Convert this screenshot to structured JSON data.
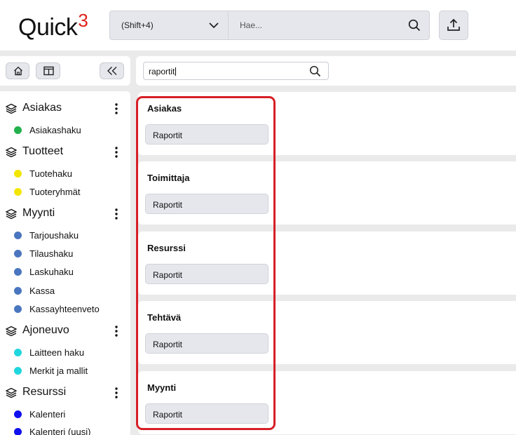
{
  "header": {
    "logo_text": "Quick",
    "logo_suffix": "3",
    "scope_label": "(Shift+4)",
    "search_placeholder": "Hae..."
  },
  "filter": {
    "value": "raportit"
  },
  "sidebar": {
    "groups": [
      {
        "label": "Asiakas",
        "items": [
          {
            "label": "Asiakashaku",
            "color": "#22b14c"
          }
        ]
      },
      {
        "label": "Tuotteet",
        "items": [
          {
            "label": "Tuotehaku",
            "color": "#f2e600"
          },
          {
            "label": "Tuoteryhmät",
            "color": "#f2e600"
          }
        ]
      },
      {
        "label": "Myynti",
        "items": [
          {
            "label": "Tarjoushaku",
            "color": "#4a76c0"
          },
          {
            "label": "Tilaushaku",
            "color": "#4a76c0"
          },
          {
            "label": "Laskuhaku",
            "color": "#4a76c0"
          },
          {
            "label": "Kassa",
            "color": "#4a76c0"
          },
          {
            "label": "Kassayhteenveto",
            "color": "#4a76c0"
          }
        ]
      },
      {
        "label": "Ajoneuvo",
        "items": [
          {
            "label": "Laitteen haku",
            "color": "#1fd6de"
          },
          {
            "label": "Merkit ja mallit",
            "color": "#1fd6de"
          }
        ]
      },
      {
        "label": "Resurssi",
        "items": [
          {
            "label": "Kalenteri",
            "color": "#1010ee"
          },
          {
            "label": "Kalenteri (uusi)",
            "color": "#1010ee"
          }
        ]
      }
    ]
  },
  "results": [
    {
      "title": "Asiakas",
      "button": "Raportit"
    },
    {
      "title": "Toimittaja",
      "button": "Raportit"
    },
    {
      "title": "Resurssi",
      "button": "Raportit"
    },
    {
      "title": "Tehtävä",
      "button": "Raportit"
    },
    {
      "title": "Myynti",
      "button": "Raportit"
    }
  ],
  "colors": {
    "accent": "#e0221a",
    "highlight": "#d61f26",
    "control_bg": "#e5e7ec"
  }
}
